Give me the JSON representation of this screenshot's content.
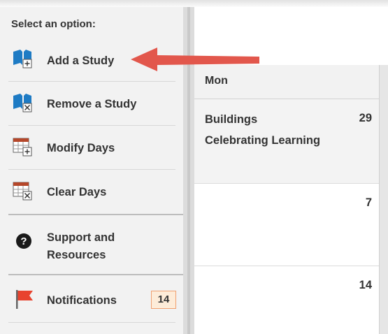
{
  "sidebar": {
    "title": "Select an option:",
    "items": [
      {
        "label": "Add a Study",
        "icon": "book-add-icon"
      },
      {
        "label": "Remove a Study",
        "icon": "book-remove-icon"
      },
      {
        "label": "Modify Days",
        "icon": "calendar-add-icon"
      },
      {
        "label": "Clear Days",
        "icon": "calendar-remove-icon"
      },
      {
        "label_line1": "Support and",
        "label_line2": "Resources",
        "icon": "help-circle-icon"
      },
      {
        "label": "Notifications",
        "icon": "flag-icon",
        "badge": "14"
      }
    ]
  },
  "calendar": {
    "column_header": "Mon",
    "days": [
      {
        "number": "29",
        "events": [
          "Buildings",
          "Celebrating Learning"
        ]
      },
      {
        "number": "7",
        "events": []
      },
      {
        "number": "14",
        "events": []
      }
    ]
  },
  "colors": {
    "book_blue": "#1e7bc4",
    "arrow_red": "#e2574c",
    "flag_red": "#e8432e",
    "badge_bg": "#fdecd9",
    "badge_border": "#f0a070"
  }
}
